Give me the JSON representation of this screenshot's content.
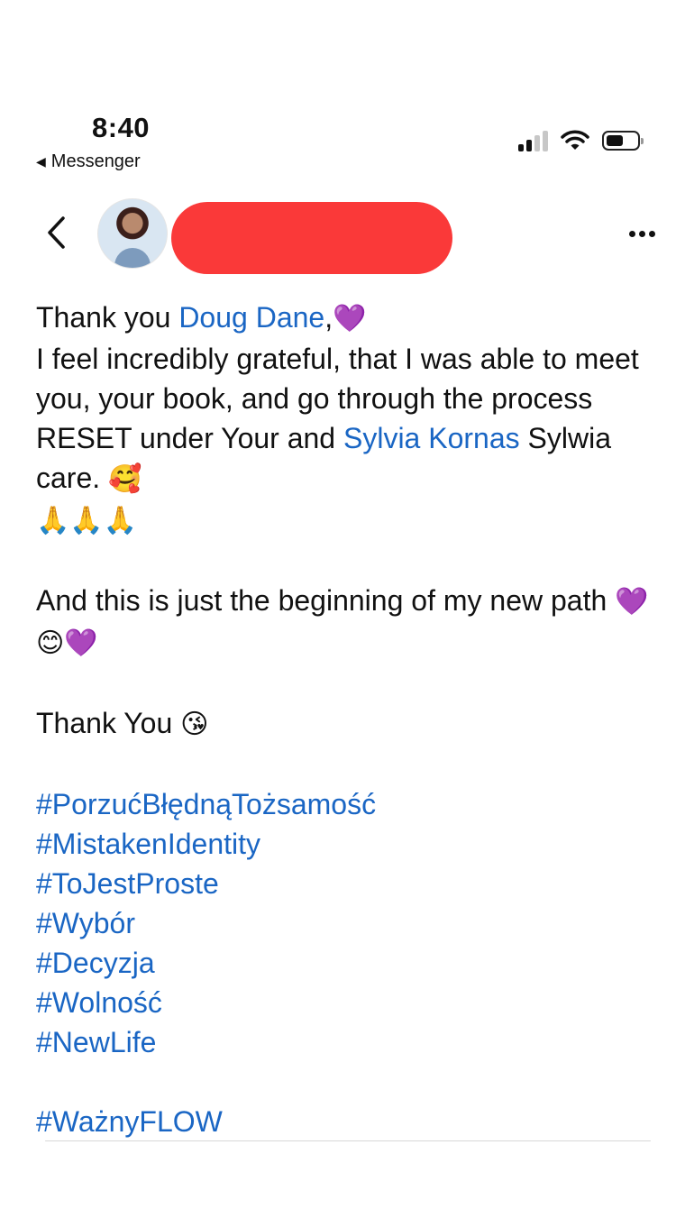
{
  "status_bar": {
    "time": "8:40",
    "back_app_label": "Messenger",
    "signal_bars_filled": 2,
    "signal_bars_total": 4,
    "battery_level": 0.55
  },
  "header": {
    "more_label": "•••"
  },
  "post": {
    "line1_prefix": "Thank you ",
    "mention1": "Doug Dane",
    "line1_suffix": ",",
    "heart": "💜",
    "para1": "I feel incredibly grateful, that I was able to meet you, your book, and go through the process RESET under Your and ",
    "mention2": "Sylvia Kornas",
    "para1_suffix": " Sylwia care. ",
    "smiling_hearts": "🥰",
    "prayers": "🙏🙏🙏",
    "para2": "And this is just the beginning of my new path ",
    "para2_emojis": "💜😊💜",
    "thanks": "Thank You ",
    "kiss": "😘",
    "hashtags": [
      "#PorzućBłędnąTożsamość",
      "#MistakenIdentity",
      "#ToJestProste",
      "#Wybór",
      "#Decyzja",
      "#Wolność",
      "#NewLife"
    ],
    "final_hashtag": "#WażnyFLOW"
  },
  "colors": {
    "link": "#1a66c4",
    "redaction": "#fa3939"
  }
}
